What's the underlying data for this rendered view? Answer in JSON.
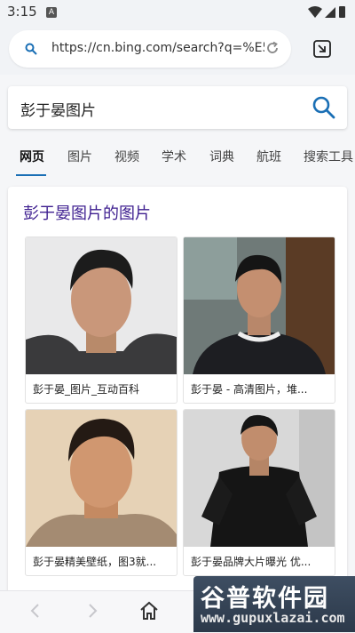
{
  "status_bar": {
    "time": "3:15",
    "notification_letter": "A"
  },
  "browser": {
    "url": "https://cn.bing.com/search?q=%E5%BD%AD%E4%BA%8E"
  },
  "search": {
    "query": "彭于晏图片"
  },
  "tabs": [
    {
      "label": "网页",
      "active": true
    },
    {
      "label": "图片",
      "active": false
    },
    {
      "label": "视频",
      "active": false
    },
    {
      "label": "学术",
      "active": false
    },
    {
      "label": "词典",
      "active": false
    },
    {
      "label": "航班",
      "active": false
    },
    {
      "label": "搜索工具",
      "active": false
    }
  ],
  "results": {
    "title": "彭于晏图片的图片",
    "images": [
      {
        "caption": "彭于晏_图片_互动百科"
      },
      {
        "caption": "彭于晏 - 高清图片，堆..."
      },
      {
        "caption": "彭于晏精美壁纸，图3就..."
      },
      {
        "caption": "彭于晏品牌大片曝光 优..."
      }
    ]
  },
  "watermark": {
    "title": "谷普软件园",
    "url": "www.gupuxlazai.com"
  },
  "colors": {
    "accent": "#1a6fb5",
    "title": "#3d1e8f"
  }
}
